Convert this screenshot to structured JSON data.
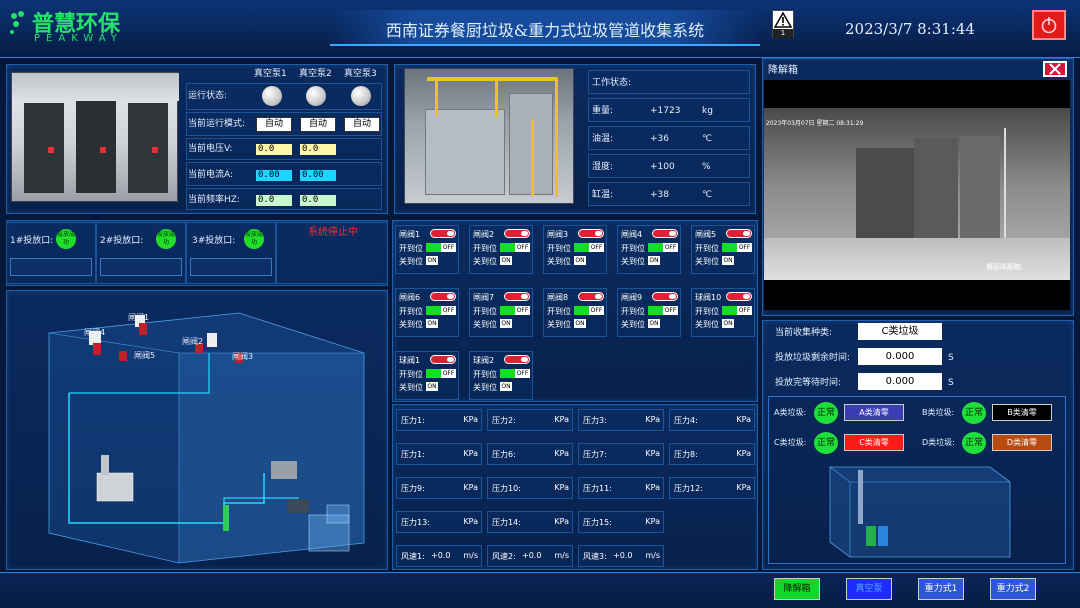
{
  "header": {
    "logo_cn": "普慧环保",
    "logo_en": "PEAKWAY",
    "title": "西南证券餐厨垃圾&重力式垃圾管道收集系统",
    "datetime": "2023/3/7 8:31:44",
    "alarm_count": "1",
    "colors": {
      "header_bg": "#0b2c66",
      "accent": "#30a0ff",
      "power": "#e41b1b"
    }
  },
  "pumps": {
    "columns": [
      "真空泵1",
      "真空泵2",
      "真空泵3"
    ],
    "row_labels": [
      "运行状态:",
      "当前运行模式:",
      "当前电压V:",
      "当前电流A:",
      "当前频率HZ:"
    ],
    "modes": [
      "自动",
      "自动",
      "自动"
    ],
    "voltage": [
      "0.0",
      "0.0"
    ],
    "current": [
      "0.00",
      "0.00"
    ],
    "frequency": [
      "0.0",
      "0.0"
    ]
  },
  "tank": {
    "status_label": "工作状态:",
    "status_value": "",
    "rows": [
      {
        "label": "重量:",
        "value": "+1723",
        "unit": "kg"
      },
      {
        "label": "油温:",
        "value": "+36",
        "unit": "℃"
      },
      {
        "label": "湿度:",
        "value": "+100",
        "unit": "%"
      },
      {
        "label": "缸温:",
        "value": "+38",
        "unit": "℃"
      }
    ]
  },
  "camera": {
    "title": "降解箱",
    "timestamp": "2023年03月07日 星期二 08:31:29",
    "caption": "餐厨降解箱"
  },
  "ports": [
    {
      "label": "1#投放口:",
      "badge": "投放成功"
    },
    {
      "label": "2#投放口:",
      "badge": "投放成功"
    },
    {
      "label": "3#投放口:",
      "badge": "投放成功"
    }
  ],
  "system_status": "系统停止中",
  "diagram_labels": [
    "闸阀1",
    "闸阀4",
    "闸阀2",
    "闸阀3",
    "闸阀5"
  ],
  "valves": [
    {
      "name": "闸阀1"
    },
    {
      "name": "闸阀2"
    },
    {
      "name": "闸阀3"
    },
    {
      "name": "闸阀4"
    },
    {
      "name": "闸阀5"
    },
    {
      "name": "闸阀6"
    },
    {
      "name": "闸阀7"
    },
    {
      "name": "闸阀8"
    },
    {
      "name": "闸阀9"
    },
    {
      "name": "球阀10"
    },
    {
      "name": "球阀1"
    },
    {
      "name": "球阀2"
    }
  ],
  "valve_labels": {
    "open": "开到位",
    "close": "关到位",
    "off": "OFF",
    "on": "ON"
  },
  "pressure": [
    {
      "label": "压力1:",
      "unit": "KPa"
    },
    {
      "label": "压力2:",
      "unit": "KPa"
    },
    {
      "label": "压力3:",
      "unit": "KPa"
    },
    {
      "label": "压力4:",
      "unit": "KPa"
    },
    {
      "label": "压力1:",
      "unit": "KPa"
    },
    {
      "label": "压力6:",
      "unit": "KPa"
    },
    {
      "label": "压力7:",
      "unit": "KPa"
    },
    {
      "label": "压力8:",
      "unit": "KPa"
    },
    {
      "label": "压力9:",
      "unit": "KPa"
    },
    {
      "label": "压力10:",
      "unit": "KPa"
    },
    {
      "label": "压力11:",
      "unit": "KPa"
    },
    {
      "label": "压力12:",
      "unit": "KPa"
    },
    {
      "label": "压力13:",
      "unit": "KPa"
    },
    {
      "label": "压力14:",
      "unit": "KPa"
    },
    {
      "label": "压力15:",
      "unit": "KPa"
    }
  ],
  "wind": [
    {
      "label": "风速1:",
      "value": "+0.0",
      "unit": "m/s"
    },
    {
      "label": "风速2:",
      "value": "+0.0",
      "unit": "m/s"
    },
    {
      "label": "风速3:",
      "value": "+0.0",
      "unit": "m/s"
    }
  ],
  "collect": {
    "type_label": "当前收集种类:",
    "type_value": "C类垃圾",
    "remain_label": "投放垃圾剩余时间:",
    "remain_value": "0.000",
    "wait_label": "投放完等待时间:",
    "wait_value": "0.000",
    "unit": "S"
  },
  "categories": [
    {
      "label": "A类垃圾:",
      "status": "正常",
      "button": "A类清零",
      "color": "#3b3db5"
    },
    {
      "label": "B类垃圾:",
      "status": "正常",
      "button": "B类清零",
      "color": "#000000"
    },
    {
      "label": "C类垃圾:",
      "status": "正常",
      "button": "C类清零",
      "color": "#ff1a1a"
    },
    {
      "label": "D类垃圾:",
      "status": "正常",
      "button": "D类清零",
      "color": "#b84b10"
    }
  ],
  "bottom_buttons": [
    {
      "label": "降解箱",
      "color": "#12d62a"
    },
    {
      "label": "真空泵",
      "color": "#1f2cff"
    },
    {
      "label": "重力式1",
      "color": "#2f56d8"
    },
    {
      "label": "重力式2",
      "color": "#2f56d8"
    }
  ]
}
